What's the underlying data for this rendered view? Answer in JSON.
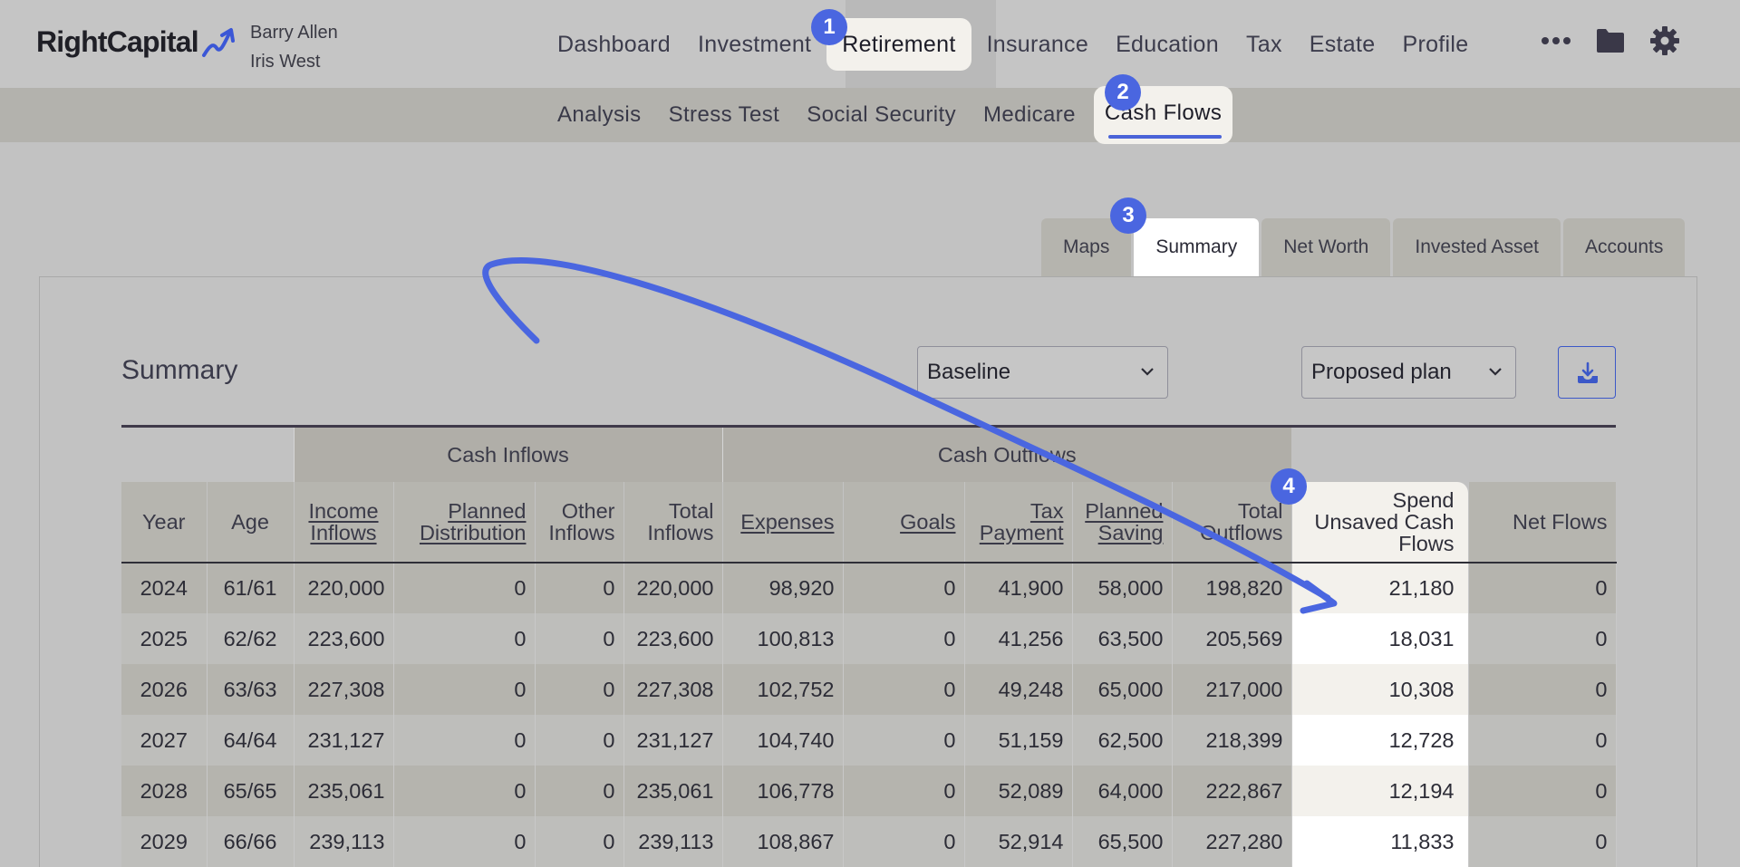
{
  "brand": {
    "name": "RightCapital"
  },
  "clients": [
    "Barry Allen",
    "Iris West"
  ],
  "main_nav": [
    "Dashboard",
    "Investment",
    "Retirement",
    "Insurance",
    "Education",
    "Tax",
    "Estate",
    "Profile"
  ],
  "main_nav_active": "Retirement",
  "nav_icons": [
    "more-icon",
    "folder-icon",
    "gear-icon"
  ],
  "sub_nav": [
    "Analysis",
    "Stress Test",
    "Social Security",
    "Medicare",
    "Cash Flows"
  ],
  "sub_nav_active": "Cash Flows",
  "view_tabs": [
    "Maps",
    "Summary",
    "Net Worth",
    "Invested Asset",
    "Accounts"
  ],
  "view_tab_active": "Summary",
  "summary": {
    "title": "Summary",
    "scenario_a": "Baseline",
    "scenario_b": "Proposed plan",
    "download_icon": "download-icon"
  },
  "steps": [
    "1",
    "2",
    "3",
    "4"
  ],
  "table": {
    "group_headers": {
      "inflows": "Cash Inflows",
      "outflows": "Cash Outflows"
    },
    "columns": {
      "year": "Year",
      "age": "Age",
      "income_inflows": [
        "Income",
        "Inflows"
      ],
      "planned_distribution": [
        "Planned",
        "Distribution"
      ],
      "other_inflows": [
        "Other",
        "Inflows"
      ],
      "total_inflows": [
        "Total",
        "Inflows"
      ],
      "expenses": "Expenses",
      "goals": "Goals",
      "tax_payment": [
        "Tax",
        "Payment"
      ],
      "planned_saving": [
        "Planned",
        "Saving"
      ],
      "total_outflows": [
        "Total",
        "Outflows"
      ],
      "spend_unsaved": [
        "Spend",
        "Unsaved Cash",
        "Flows"
      ],
      "net_flows": "Net Flows"
    },
    "rows": [
      [
        "2024",
        "61/61",
        "220,000",
        "0",
        "0",
        "220,000",
        "98,920",
        "0",
        "41,900",
        "58,000",
        "198,820",
        "21,180",
        "0"
      ],
      [
        "2025",
        "62/62",
        "223,600",
        "0",
        "0",
        "223,600",
        "100,813",
        "0",
        "41,256",
        "63,500",
        "205,569",
        "18,031",
        "0"
      ],
      [
        "2026",
        "63/63",
        "227,308",
        "0",
        "0",
        "227,308",
        "102,752",
        "0",
        "49,248",
        "65,000",
        "217,000",
        "10,308",
        "0"
      ],
      [
        "2027",
        "64/64",
        "231,127",
        "0",
        "0",
        "231,127",
        "104,740",
        "0",
        "51,159",
        "62,500",
        "218,399",
        "12,728",
        "0"
      ],
      [
        "2028",
        "65/65",
        "235,061",
        "0",
        "0",
        "235,061",
        "106,778",
        "0",
        "52,089",
        "64,000",
        "222,867",
        "12,194",
        "0"
      ],
      [
        "2029",
        "66/66",
        "239,113",
        "0",
        "0",
        "239,113",
        "108,867",
        "0",
        "52,914",
        "65,500",
        "227,280",
        "11,833",
        "0"
      ]
    ]
  }
}
